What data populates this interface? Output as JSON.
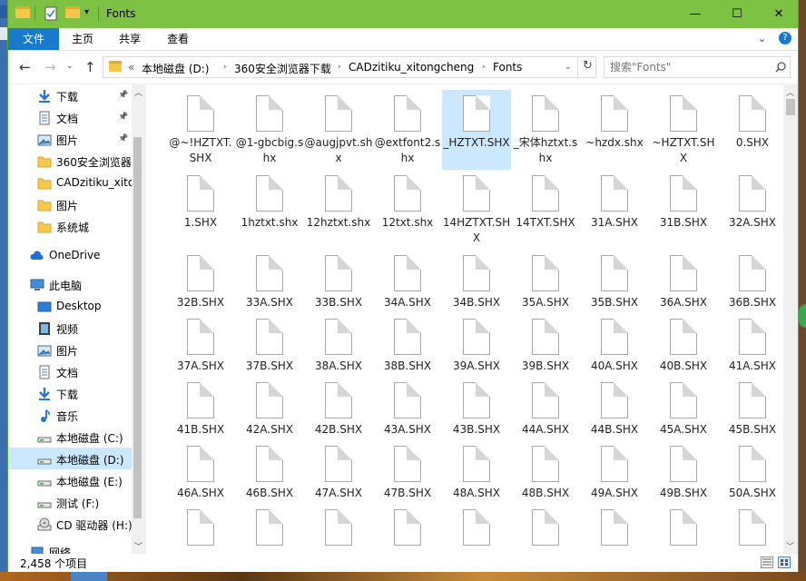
{
  "window": {
    "title": "Fonts",
    "controls": {
      "minimize": "—",
      "maximize": "☐",
      "close": "✕"
    }
  },
  "ribbon": {
    "tabs": [
      "文件",
      "主页",
      "共享",
      "查看"
    ]
  },
  "address": {
    "prefix": "«",
    "crumbs": [
      "本地磁盘 (D:)",
      "360安全浏览器下载",
      "CADzitiku_xitongcheng",
      "Fonts"
    ]
  },
  "search": {
    "placeholder": "搜索\"Fonts\""
  },
  "navpane": {
    "items": [
      {
        "label": "下载",
        "icon": "download-arrow-icon",
        "pinned": true
      },
      {
        "label": "文档",
        "icon": "document-icon",
        "pinned": true
      },
      {
        "label": "图片",
        "icon": "picture-icon",
        "pinned": true
      },
      {
        "label": "360安全浏览器",
        "icon": "folder-icon",
        "pinned": false
      },
      {
        "label": "CADzitiku_xito",
        "icon": "folder-icon",
        "pinned": false
      },
      {
        "label": "图片",
        "icon": "folder-icon",
        "pinned": false
      },
      {
        "label": "系统城",
        "icon": "folder-icon",
        "pinned": false
      },
      {
        "label": "OneDrive",
        "icon": "cloud-icon",
        "pinned": false
      },
      {
        "label": "此电脑",
        "icon": "computer-icon",
        "pinned": false
      },
      {
        "label": "Desktop",
        "icon": "desktop-icon",
        "pinned": false
      },
      {
        "label": "视频",
        "icon": "video-icon",
        "pinned": false
      },
      {
        "label": "图片",
        "icon": "picture-icon",
        "pinned": false
      },
      {
        "label": "文档",
        "icon": "document-icon",
        "pinned": false
      },
      {
        "label": "下载",
        "icon": "download-arrow-icon",
        "pinned": false
      },
      {
        "label": "音乐",
        "icon": "music-note-icon",
        "pinned": false
      },
      {
        "label": "本地磁盘 (C:)",
        "icon": "drive-icon",
        "pinned": false
      },
      {
        "label": "本地磁盘 (D:)",
        "icon": "drive-icon",
        "pinned": false,
        "selected": true
      },
      {
        "label": "本地磁盘 (E:)",
        "icon": "drive-icon",
        "pinned": false
      },
      {
        "label": "测试 (F:)",
        "icon": "drive-icon",
        "pinned": false
      },
      {
        "label": "CD 驱动器 (H:)",
        "icon": "cd-drive-icon",
        "pinned": false
      },
      {
        "label": "网络",
        "icon": "network-icon",
        "pinned": false
      }
    ]
  },
  "files": [
    "@~!HZTXT.SHX",
    "@1-gbcbig.shx",
    "@augjpvt.shx",
    "@extfont2.shx",
    "_HZTXT.SHX",
    "_宋体hztxt.shx",
    "~hzdx.shx",
    "~HZTXT.SHX",
    "0.SHX",
    "1.SHX",
    "1hztxt.shx",
    "12hztxt.shx",
    "12txt.shx",
    "14HZTXT.SHX",
    "14TXT.SHX",
    "31A.SHX",
    "31B.SHX",
    "32A.SHX",
    "32B.SHX",
    "33A.SHX",
    "33B.SHX",
    "34A.SHX",
    "34B.SHX",
    "35A.SHX",
    "35B.SHX",
    "36A.SHX",
    "36B.SHX",
    "37A.SHX",
    "37B.SHX",
    "38A.SHX",
    "38B.SHX",
    "39A.SHX",
    "39B.SHX",
    "40A.SHX",
    "40B.SHX",
    "41A.SHX",
    "41B.SHX",
    "42A.SHX",
    "42B.SHX",
    "43A.SHX",
    "43B.SHX",
    "44A.SHX",
    "44B.SHX",
    "45A.SHX",
    "45B.SHX",
    "46A.SHX",
    "46B.SHX",
    "47A.SHX",
    "47B.SHX",
    "48A.SHX",
    "48B.SHX",
    "49A.SHX",
    "49B.SHX",
    "50A.SHX",
    "",
    "",
    "",
    "",
    "",
    "",
    "",
    "",
    ""
  ],
  "file_display": [
    "@~!HZTXT.SHX",
    "@1-gbcbig.shx",
    "@augjpvt.shx",
    "@extfont2.shx",
    "_HZTXT.SHX",
    "_宋体 hztxt.shx",
    "~hzdx.shx",
    "~HZTXT.SHX",
    "0.SHX"
  ],
  "selected_file_index": 4,
  "status": {
    "count": "2,458 个项目"
  },
  "colors": {
    "titlebar": "#7ec244",
    "file_tab": "#1979ca",
    "selection": "#cce8ff"
  }
}
